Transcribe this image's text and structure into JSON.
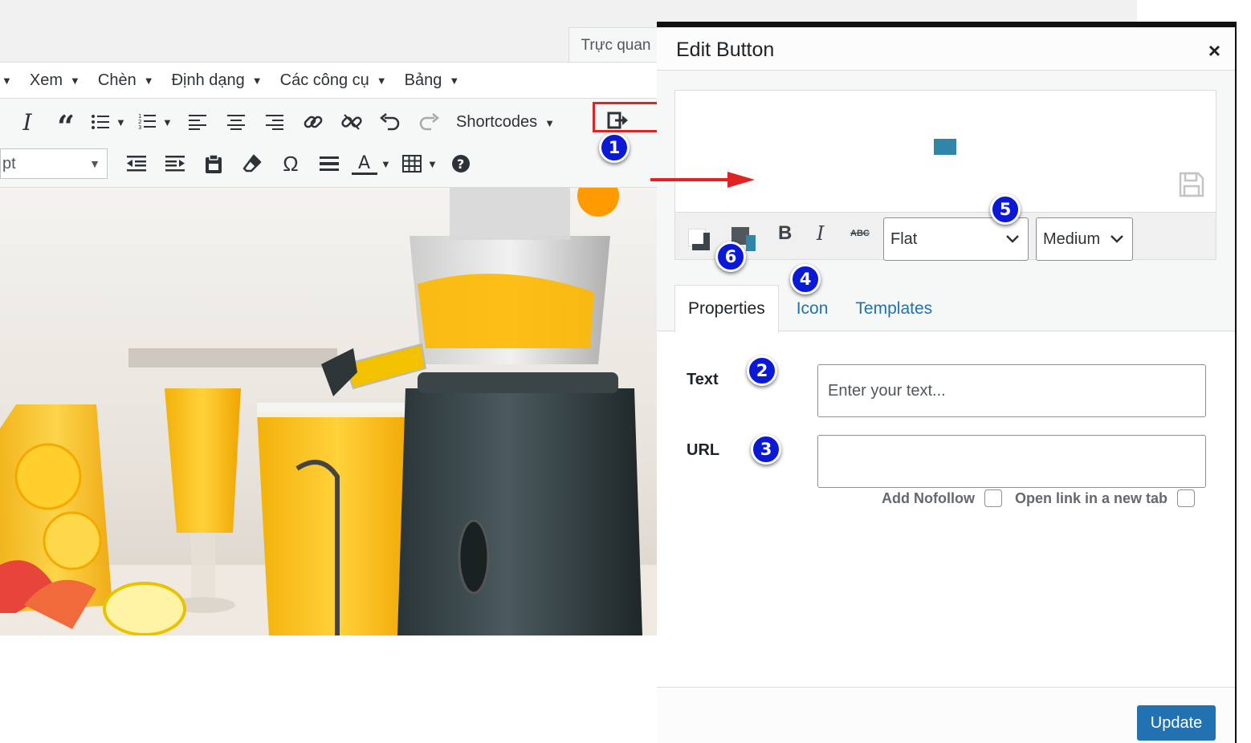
{
  "editor": {
    "visual_tab_label": "Trực quan",
    "menu": [
      {
        "label": ""
      },
      {
        "label": "Xem"
      },
      {
        "label": "Chèn"
      },
      {
        "label": "Định dạng"
      },
      {
        "label": "Các công cụ"
      },
      {
        "label": "Bảng"
      }
    ],
    "shortcodes_label": "Shortcodes",
    "font_size_value": "pt"
  },
  "annotations": [
    "1",
    "2",
    "3",
    "4",
    "5",
    "6"
  ],
  "dialog": {
    "title": "Edit Button",
    "close_glyph": "×",
    "style_dropdown_value": "Flat",
    "size_dropdown_value": "Medium",
    "tabs": [
      "Properties",
      "Icon",
      "Templates"
    ],
    "fields": {
      "text_label": "Text",
      "text_placeholder": "Enter your text...",
      "url_label": "URL",
      "url_value": ""
    },
    "options": {
      "nofollow_label": "Add Nofollow",
      "new_tab_label": "Open link in a new tab"
    },
    "update_label": "Update",
    "colors": {
      "preview_button": "#2f86a8",
      "primary": "#2271b1",
      "highlight": "#e02424",
      "badge": "#0a18d8"
    }
  }
}
